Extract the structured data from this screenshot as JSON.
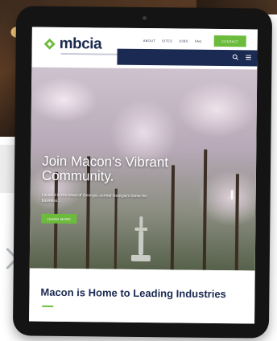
{
  "site": {
    "logo_text": "mbcia"
  },
  "header": {
    "nav_items": [
      "About",
      "Sites",
      "Jobs",
      "Fag"
    ],
    "contact_label": "CONTACT"
  },
  "hero": {
    "title": "Join Macon's Vibrant Community.",
    "body": "Located in the heart of Georgia, central Georgia's home for business...",
    "button_label": "LEARN MORE"
  },
  "section": {
    "title": "Macon is Home to Leading Industries"
  },
  "icons": {
    "search": "search-icon",
    "menu": "menu-icon"
  },
  "colors": {
    "brand_navy": "#1b2a52",
    "brand_green": "#6dbb3c"
  }
}
